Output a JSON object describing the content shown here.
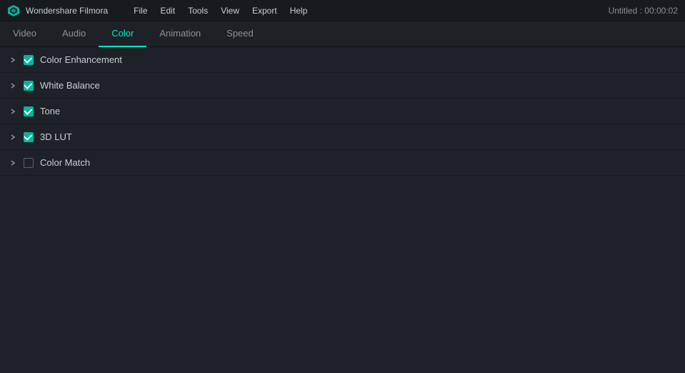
{
  "titleBar": {
    "appName": "Wondershare Filmora",
    "menuItems": [
      "File",
      "Edit",
      "Tools",
      "View",
      "Export",
      "Help"
    ],
    "projectTitle": "Untitled : 00:00:02"
  },
  "tabs": [
    {
      "id": "video",
      "label": "Video",
      "active": false
    },
    {
      "id": "audio",
      "label": "Audio",
      "active": false
    },
    {
      "id": "color",
      "label": "Color",
      "active": true
    },
    {
      "id": "animation",
      "label": "Animation",
      "active": false
    },
    {
      "id": "speed",
      "label": "Speed",
      "active": false
    }
  ],
  "sections": [
    {
      "id": "color-enhancement",
      "label": "Color Enhancement",
      "checked": true,
      "expanded": false
    },
    {
      "id": "white-balance",
      "label": "White Balance",
      "checked": true,
      "expanded": false
    },
    {
      "id": "tone",
      "label": "Tone",
      "checked": true,
      "expanded": false
    },
    {
      "id": "3d-lut",
      "label": "3D LUT",
      "checked": true,
      "expanded": false
    },
    {
      "id": "color-match",
      "label": "Color Match",
      "checked": false,
      "expanded": false
    }
  ]
}
